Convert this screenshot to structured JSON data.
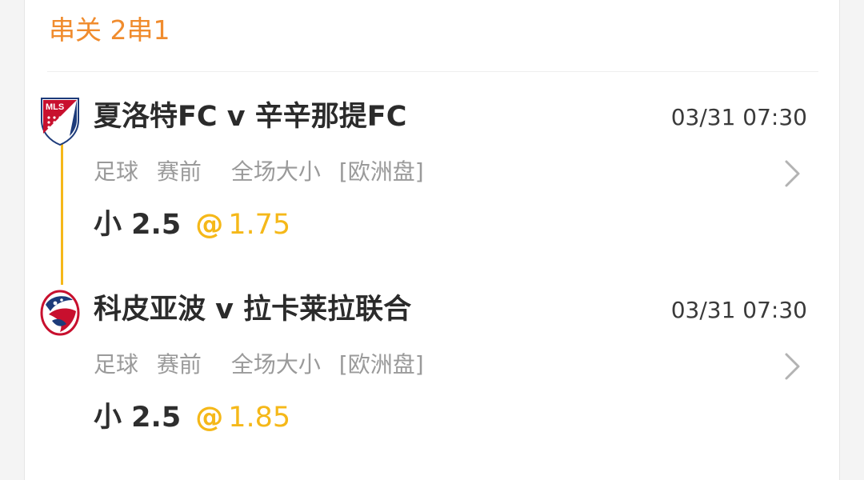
{
  "header": {
    "title": "串关 2串1"
  },
  "colors": {
    "accent_orange": "#f08c2e",
    "accent_gold": "#f5b819",
    "text_dark": "#2b2b2b",
    "text_muted": "#9a9a9a",
    "mls_red": "#c8102e",
    "usl_blue": "#1d3b7a"
  },
  "bets": [
    {
      "league_icon": "mls-logo-icon",
      "league_icon_text": "MLS",
      "match": "夏洛特FC v 辛辛那提FC",
      "time": "03/31 07:30",
      "sport": "足球",
      "stage": "赛前",
      "market": "全场大小",
      "odds_format": "[欧洲盘]",
      "selection": "小 2.5",
      "at": "@",
      "odds": "1.75"
    },
    {
      "league_icon": "usl-logo-icon",
      "match": "科皮亚波 v 拉卡莱拉联合",
      "time": "03/31 07:30",
      "sport": "足球",
      "stage": "赛前",
      "market": "全场大小",
      "odds_format": "[欧洲盘]",
      "selection": "小 2.5",
      "at": "@",
      "odds": "1.85"
    }
  ]
}
